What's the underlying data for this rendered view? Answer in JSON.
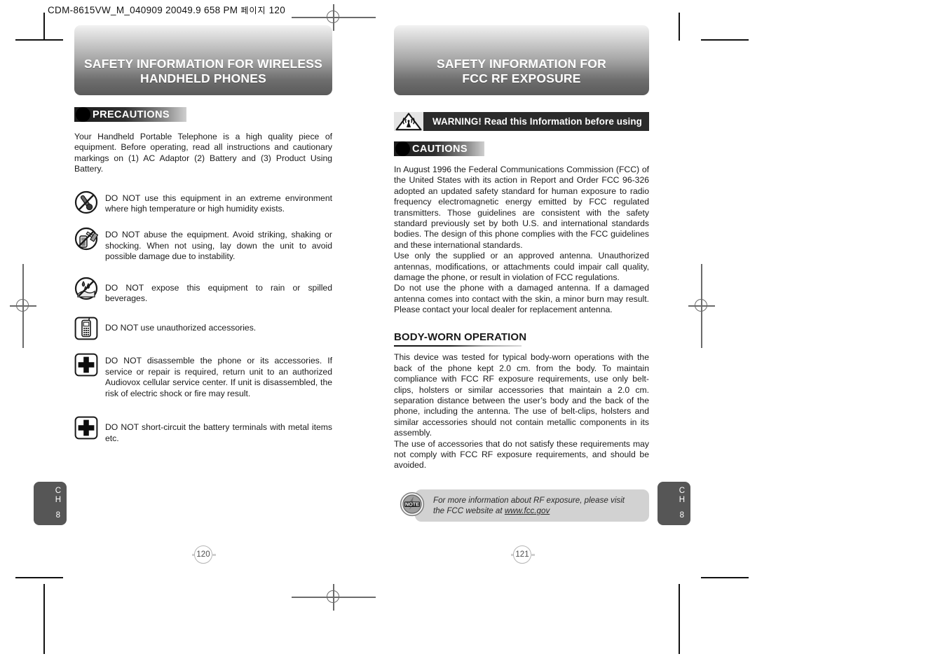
{
  "print_header": {
    "text": "CDM-8615VW_M_040909  20049.9 658 PM",
    "korean": "페이지",
    "page_ref": "120"
  },
  "left_page": {
    "banner": {
      "line1": "SAFETY INFORMATION FOR WIRELESS",
      "line2": "HANDHELD PHONES"
    },
    "tag": "PRECAUTIONS",
    "intro": "Your Handheld Portable Telephone is a high quality piece of equipment.  Before operating, read all instructions and cautionary markings on (1) AC Adaptor (2) Battery and (3) Product Using Battery.",
    "items": [
      {
        "icon": "no-heat-humidity-icon",
        "text": "DO NOT use this equipment in an extreme environment where high temperature or high humidity exists."
      },
      {
        "icon": "no-abuse-phone-icon",
        "text": "DO NOT abuse the equipment.  Avoid striking, shaking or shocking.  When not using, lay down the unit to avoid possible damage due to instability."
      },
      {
        "icon": "no-liquid-icon",
        "text": "DO NOT expose this equipment to rain or spilled beverages."
      },
      {
        "icon": "no-unauthorized-accessory-icon",
        "text": "DO NOT use unauthorized accessories."
      },
      {
        "icon": "no-disassemble-icon",
        "text": "DO NOT disassemble the phone or its accessories.  If service or repair is required, return unit to an authorized Audiovox cellular service center.  If unit is disassembled, the risk of electric shock or fire may result."
      },
      {
        "icon": "no-short-circuit-icon",
        "text": "DO NOT short-circuit the battery terminals with metal items etc."
      }
    ],
    "chapter_tab": {
      "letters": "C\nH",
      "letter1": "C",
      "letter2": "H",
      "number": "8"
    },
    "page_number": "120"
  },
  "right_page": {
    "banner": {
      "line1": "SAFETY INFORMATION FOR",
      "line2": "FCC RF EXPOSURE"
    },
    "warning_bar": "WARNING! Read this Information before using",
    "tag": "CAUTIONS",
    "paragraphs": [
      "In August 1996 the Federal Communications Commission (FCC) of the United States with its action in Report and Order FCC 96-326 adopted an updated safety standard for human exposure to radio frequency electromagnetic energy emitted by FCC regulated transmitters. Those guidelines are consistent with the safety standard previously set by both U.S. and international standards bodies. The design of this phone complies with the FCC guidelines and these international standards.",
      "Use only the supplied or an approved antenna. Unauthorized antennas, modifications, or attachments could impair call quality, damage the phone, or result in violation of FCC regulations.",
      "Do not use the phone with a damaged antenna. If a damaged antenna comes into contact with the skin, a minor burn may result. Please contact your local dealer for replacement antenna."
    ],
    "subhead": "BODY-WORN OPERATION",
    "body_worn_paragraphs": [
      "This device was tested for typical body-worn operations with the back of the phone kept 2.0 cm. from the body. To maintain compliance with FCC RF exposure requirements, use only belt-clips, holsters or similar accessories that maintain a 2.0 cm. separation distance between the user’s body and the back of the phone, including the antenna. The use of belt-clips, holsters and similar accessories should not contain metallic components in its assembly.",
      "The use of accessories that do not satisfy these requirements may not comply with FCC RF exposure requirements, and should be avoided."
    ],
    "note": {
      "icon_label": "NOTE",
      "text_before": "For more information about RF exposure, please visit the FCC website at ",
      "url": "www.fcc.gov"
    },
    "chapter_tab": {
      "letter1": "C",
      "letter2": "H",
      "number": "8"
    },
    "page_number": "121"
  },
  "colors": {
    "banner_dark": "#5a5a5a",
    "banner_light": "#f2f2f2",
    "tag_black": "#1a1a1a",
    "warn_bar": "#2b2b2b",
    "note_box": "#d2d2d2",
    "chapter_tab": "#565656"
  }
}
